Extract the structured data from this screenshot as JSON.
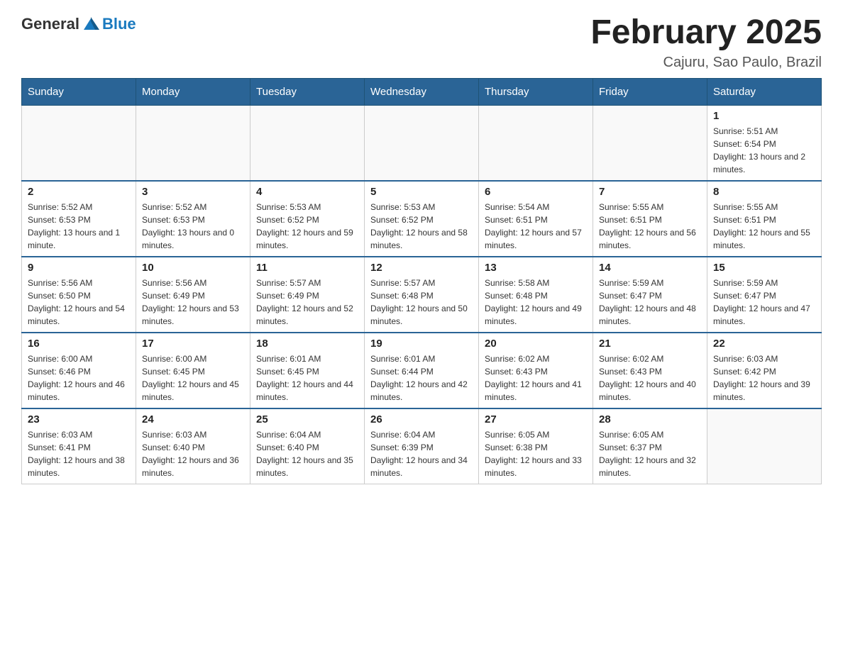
{
  "header": {
    "logo": {
      "text_general": "General",
      "text_blue": "Blue"
    },
    "title": "February 2025",
    "location": "Cajuru, Sao Paulo, Brazil"
  },
  "days_of_week": [
    "Sunday",
    "Monday",
    "Tuesday",
    "Wednesday",
    "Thursday",
    "Friday",
    "Saturday"
  ],
  "weeks": [
    {
      "days": [
        {
          "number": "",
          "info": ""
        },
        {
          "number": "",
          "info": ""
        },
        {
          "number": "",
          "info": ""
        },
        {
          "number": "",
          "info": ""
        },
        {
          "number": "",
          "info": ""
        },
        {
          "number": "",
          "info": ""
        },
        {
          "number": "1",
          "info": "Sunrise: 5:51 AM\nSunset: 6:54 PM\nDaylight: 13 hours and 2 minutes."
        }
      ]
    },
    {
      "days": [
        {
          "number": "2",
          "info": "Sunrise: 5:52 AM\nSunset: 6:53 PM\nDaylight: 13 hours and 1 minute."
        },
        {
          "number": "3",
          "info": "Sunrise: 5:52 AM\nSunset: 6:53 PM\nDaylight: 13 hours and 0 minutes."
        },
        {
          "number": "4",
          "info": "Sunrise: 5:53 AM\nSunset: 6:52 PM\nDaylight: 12 hours and 59 minutes."
        },
        {
          "number": "5",
          "info": "Sunrise: 5:53 AM\nSunset: 6:52 PM\nDaylight: 12 hours and 58 minutes."
        },
        {
          "number": "6",
          "info": "Sunrise: 5:54 AM\nSunset: 6:51 PM\nDaylight: 12 hours and 57 minutes."
        },
        {
          "number": "7",
          "info": "Sunrise: 5:55 AM\nSunset: 6:51 PM\nDaylight: 12 hours and 56 minutes."
        },
        {
          "number": "8",
          "info": "Sunrise: 5:55 AM\nSunset: 6:51 PM\nDaylight: 12 hours and 55 minutes."
        }
      ]
    },
    {
      "days": [
        {
          "number": "9",
          "info": "Sunrise: 5:56 AM\nSunset: 6:50 PM\nDaylight: 12 hours and 54 minutes."
        },
        {
          "number": "10",
          "info": "Sunrise: 5:56 AM\nSunset: 6:49 PM\nDaylight: 12 hours and 53 minutes."
        },
        {
          "number": "11",
          "info": "Sunrise: 5:57 AM\nSunset: 6:49 PM\nDaylight: 12 hours and 52 minutes."
        },
        {
          "number": "12",
          "info": "Sunrise: 5:57 AM\nSunset: 6:48 PM\nDaylight: 12 hours and 50 minutes."
        },
        {
          "number": "13",
          "info": "Sunrise: 5:58 AM\nSunset: 6:48 PM\nDaylight: 12 hours and 49 minutes."
        },
        {
          "number": "14",
          "info": "Sunrise: 5:59 AM\nSunset: 6:47 PM\nDaylight: 12 hours and 48 minutes."
        },
        {
          "number": "15",
          "info": "Sunrise: 5:59 AM\nSunset: 6:47 PM\nDaylight: 12 hours and 47 minutes."
        }
      ]
    },
    {
      "days": [
        {
          "number": "16",
          "info": "Sunrise: 6:00 AM\nSunset: 6:46 PM\nDaylight: 12 hours and 46 minutes."
        },
        {
          "number": "17",
          "info": "Sunrise: 6:00 AM\nSunset: 6:45 PM\nDaylight: 12 hours and 45 minutes."
        },
        {
          "number": "18",
          "info": "Sunrise: 6:01 AM\nSunset: 6:45 PM\nDaylight: 12 hours and 44 minutes."
        },
        {
          "number": "19",
          "info": "Sunrise: 6:01 AM\nSunset: 6:44 PM\nDaylight: 12 hours and 42 minutes."
        },
        {
          "number": "20",
          "info": "Sunrise: 6:02 AM\nSunset: 6:43 PM\nDaylight: 12 hours and 41 minutes."
        },
        {
          "number": "21",
          "info": "Sunrise: 6:02 AM\nSunset: 6:43 PM\nDaylight: 12 hours and 40 minutes."
        },
        {
          "number": "22",
          "info": "Sunrise: 6:03 AM\nSunset: 6:42 PM\nDaylight: 12 hours and 39 minutes."
        }
      ]
    },
    {
      "days": [
        {
          "number": "23",
          "info": "Sunrise: 6:03 AM\nSunset: 6:41 PM\nDaylight: 12 hours and 38 minutes."
        },
        {
          "number": "24",
          "info": "Sunrise: 6:03 AM\nSunset: 6:40 PM\nDaylight: 12 hours and 36 minutes."
        },
        {
          "number": "25",
          "info": "Sunrise: 6:04 AM\nSunset: 6:40 PM\nDaylight: 12 hours and 35 minutes."
        },
        {
          "number": "26",
          "info": "Sunrise: 6:04 AM\nSunset: 6:39 PM\nDaylight: 12 hours and 34 minutes."
        },
        {
          "number": "27",
          "info": "Sunrise: 6:05 AM\nSunset: 6:38 PM\nDaylight: 12 hours and 33 minutes."
        },
        {
          "number": "28",
          "info": "Sunrise: 6:05 AM\nSunset: 6:37 PM\nDaylight: 12 hours and 32 minutes."
        },
        {
          "number": "",
          "info": ""
        }
      ]
    }
  ]
}
